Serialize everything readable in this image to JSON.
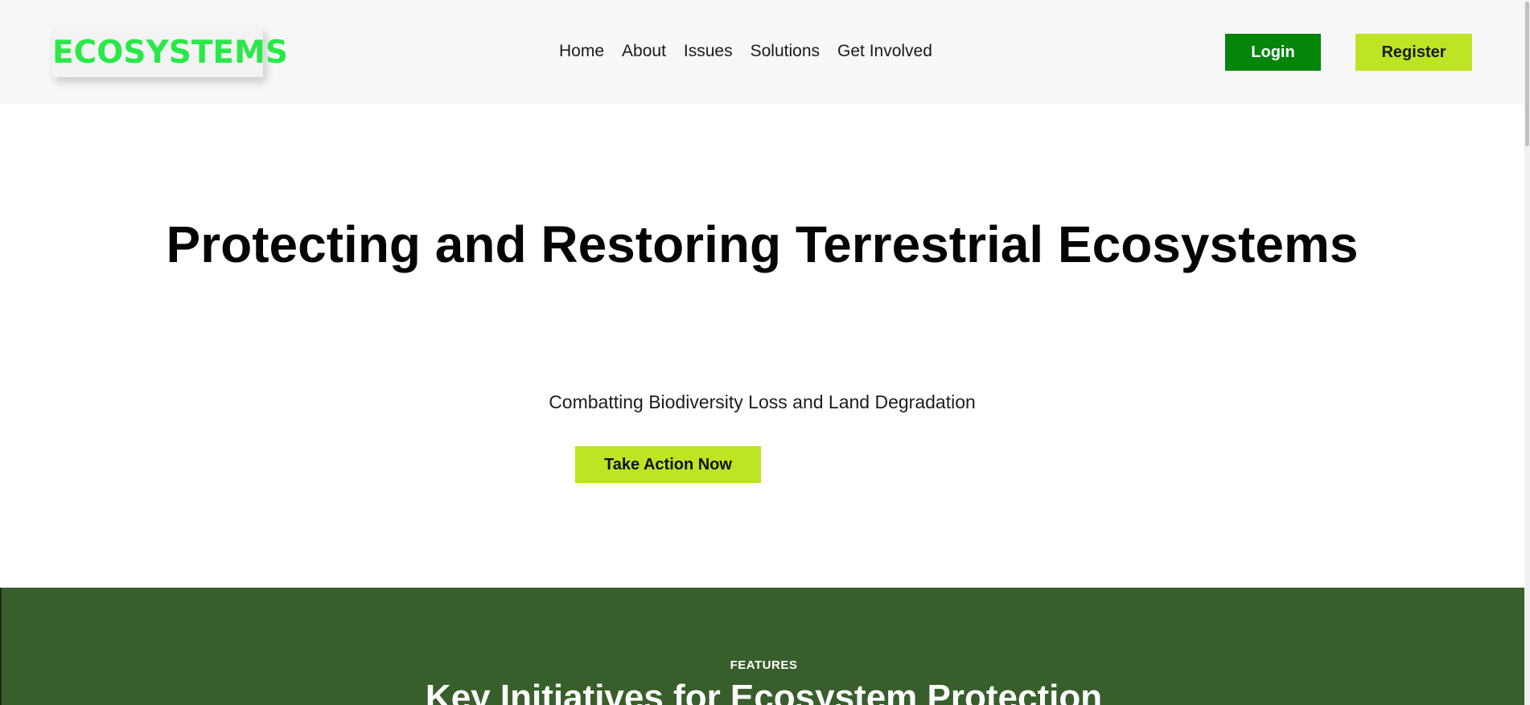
{
  "header": {
    "logo": "ECOSYSTEMS",
    "nav": [
      {
        "label": "Home"
      },
      {
        "label": "About"
      },
      {
        "label": "Issues"
      },
      {
        "label": "Solutions"
      },
      {
        "label": "Get Involved"
      }
    ],
    "login_label": "Login",
    "register_label": "Register"
  },
  "hero": {
    "title": "Protecting and Restoring Terrestrial Ecosystems",
    "subtitle": "Combatting Biodiversity Loss and Land Degradation",
    "cta_label": "Take Action Now"
  },
  "features": {
    "eyebrow": "FEATURES",
    "heading": "Key Initiatives for Ecosystem Protection"
  },
  "colors": {
    "logo_green": "#2be84a",
    "login_bg": "#05850a",
    "accent_lime": "#bde523",
    "features_bg": "#385f2b"
  }
}
